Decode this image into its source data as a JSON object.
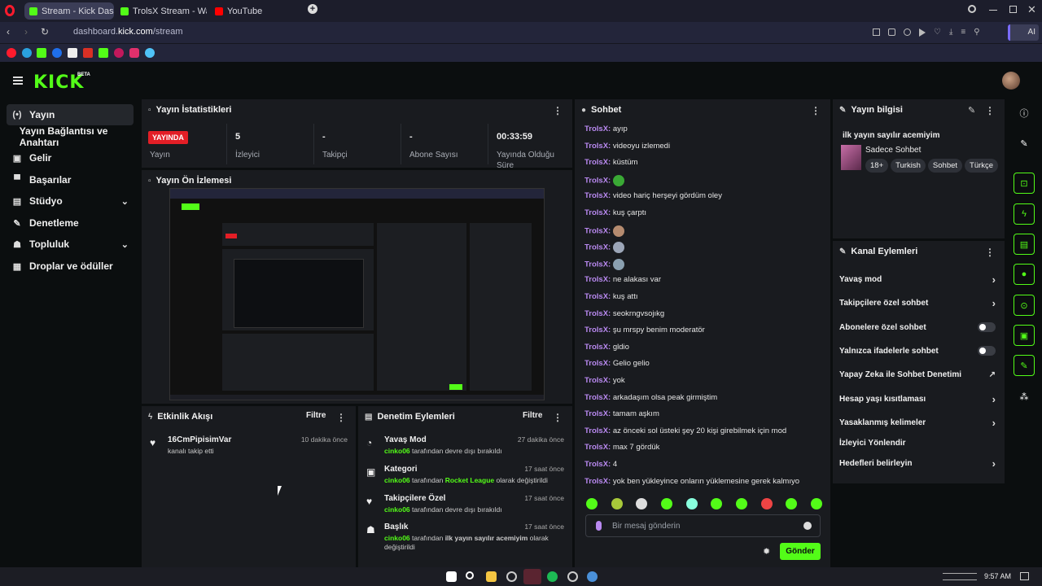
{
  "browser": {
    "tabs": [
      {
        "label": "Stream - Kick Dashboard"
      },
      {
        "label": "TrolsX Stream - Watch Liv"
      },
      {
        "label": "YouTube"
      }
    ],
    "url_prefix": "dashboard.",
    "url_host": "kick.com",
    "url_path": "/stream",
    "ai_label": "AI"
  },
  "app": {
    "logo": "KICK",
    "logo_badge": "BETA",
    "accent_color": "#53fc18"
  },
  "sidebar": {
    "items": [
      {
        "label": "Yayın",
        "icon": "broadcast-icon"
      },
      {
        "label": "Yayın Bağlantısı ve Anahtarı",
        "icon": ""
      },
      {
        "label": "Gelir",
        "icon": "dollar-icon"
      },
      {
        "label": "Başarılar",
        "icon": "trophy-icon"
      },
      {
        "label": "Stüdyo",
        "icon": "studio-icon"
      },
      {
        "label": "Denetleme",
        "icon": "wrench-icon"
      },
      {
        "label": "Topluluk",
        "icon": "users-icon"
      },
      {
        "label": "Droplar ve ödüller",
        "icon": "gift-icon"
      }
    ]
  },
  "stats": {
    "title": "Yayın İstatistikleri",
    "live_badge": "YAYINDA",
    "live_label": "Yayın",
    "viewers_value": "5",
    "viewers_label": "İzleyici",
    "followers_value": "-",
    "followers_label": "Takipçi",
    "subs_value": "-",
    "subs_label": "Abone Sayısı",
    "duration_value": "00:33:59",
    "duration_label": "Yayında Olduğu Süre"
  },
  "preview": {
    "title": "Yayın Ön İzlemesi"
  },
  "activity": {
    "title": "Etkinlik Akışı",
    "filter": "Filtre",
    "events": [
      {
        "user": "16CmPipisimVar",
        "text": "kanalı takip etti",
        "time": "10 dakika önce"
      }
    ]
  },
  "moderation": {
    "title": "Denetim Eylemleri",
    "filter": "Filtre",
    "events": [
      {
        "title": "Yavaş Mod",
        "time": "27 dakika önce",
        "mod": "cinko06",
        "text": "tarafından devre dışı bırakıldı",
        "extra": "",
        "extra2": ""
      },
      {
        "title": "Kategori",
        "time": "17 saat önce",
        "mod": "cinko06",
        "text": "tarafından",
        "extra": "Rocket League",
        "extra2": "olarak değiştirildi"
      },
      {
        "title": "Takipçilere Özel",
        "time": "17 saat önce",
        "mod": "cinko06",
        "text": "tarafından devre dışı bırakıldı",
        "extra": "",
        "extra2": ""
      },
      {
        "title": "Başlık",
        "time": "17 saat önce",
        "mod": "cinko06",
        "text": "tarafından",
        "extra": "ilk yayın sayılır acemiyim",
        "extra2": "olarak değiştirildi"
      }
    ]
  },
  "chat": {
    "title": "Sohbet",
    "messages": [
      {
        "user": "TrolsX:",
        "text": "ayıp"
      },
      {
        "user": "TrolsX:",
        "text": "videoyu izlemedi"
      },
      {
        "user": "TrolsX:",
        "text": "küstüm"
      },
      {
        "user": "TrolsX:",
        "text": "",
        "emoji": "#3aa935"
      },
      {
        "user": "TrolsX:",
        "text": "video hariç herşeyi gördüm oley"
      },
      {
        "user": "TrolsX:",
        "text": "kuş çarptı"
      },
      {
        "user": "TrolsX:",
        "text": "",
        "emoji": "#b58b6f"
      },
      {
        "user": "TrolsX:",
        "text": "",
        "emoji": "#9ca6b8"
      },
      {
        "user": "TrolsX:",
        "text": "",
        "emoji": "#8aa0b0"
      },
      {
        "user": "TrolsX:",
        "text": "ne alakası var"
      },
      {
        "user": "TrolsX:",
        "text": "kuş attı"
      },
      {
        "user": "TrolsX:",
        "text": "seokrngvsojıkg"
      },
      {
        "user": "TrolsX:",
        "text": "şu mrspy benim moderatör"
      },
      {
        "user": "TrolsX:",
        "text": "gldio"
      },
      {
        "user": "TrolsX:",
        "text": "Gelio gelio"
      },
      {
        "user": "TrolsX:",
        "text": "yok"
      },
      {
        "user": "TrolsX:",
        "text": "arkadaşım olsa peak girmiştim"
      },
      {
        "user": "TrolsX:",
        "text": "tamam aşkım"
      },
      {
        "user": "TrolsX:",
        "text": "az önceki sol üsteki şey 20 kişi girebilmek için mod"
      },
      {
        "user": "TrolsX:",
        "text": "max 7 gördük"
      },
      {
        "user": "TrolsX:",
        "text": "4"
      },
      {
        "user": "TrolsX:",
        "text": "yok ben yükleyince onların yüklemesine gerek kalmıyo"
      }
    ],
    "input_placeholder": "Bir mesaj gönderin",
    "send_label": "Gönder"
  },
  "stream_info": {
    "title": "Yayın bilgisi",
    "stream_title": "ilk yayın sayılır acemiyim",
    "chat_mode": "Sadece Sohbet",
    "tags": [
      "18+",
      "Turkish",
      "Sohbet",
      "Türkçe"
    ]
  },
  "channel_actions": {
    "title": "Kanal Eylemleri",
    "items": [
      {
        "label": "Yavaş mod",
        "control": "arrow"
      },
      {
        "label": "Takipçilere özel sohbet",
        "control": "arrow"
      },
      {
        "label": "Abonelere özel sohbet",
        "control": "toggle"
      },
      {
        "label": "Yalnızca ifadelerle sohbet",
        "control": "toggle"
      },
      {
        "label": "Yapay Zeka ile Sohbet Denetimi",
        "control": "external"
      },
      {
        "label": "Hesap yaşı kısıtlaması",
        "control": "arrow"
      },
      {
        "label": "Yasaklanmış kelimeler",
        "control": "arrow"
      },
      {
        "label": "İzleyici Yönlendir",
        "control": "none"
      },
      {
        "label": "Hedefleri belirleyin",
        "control": "arrow"
      }
    ]
  },
  "taskbar": {
    "time": "9:57 AM"
  }
}
